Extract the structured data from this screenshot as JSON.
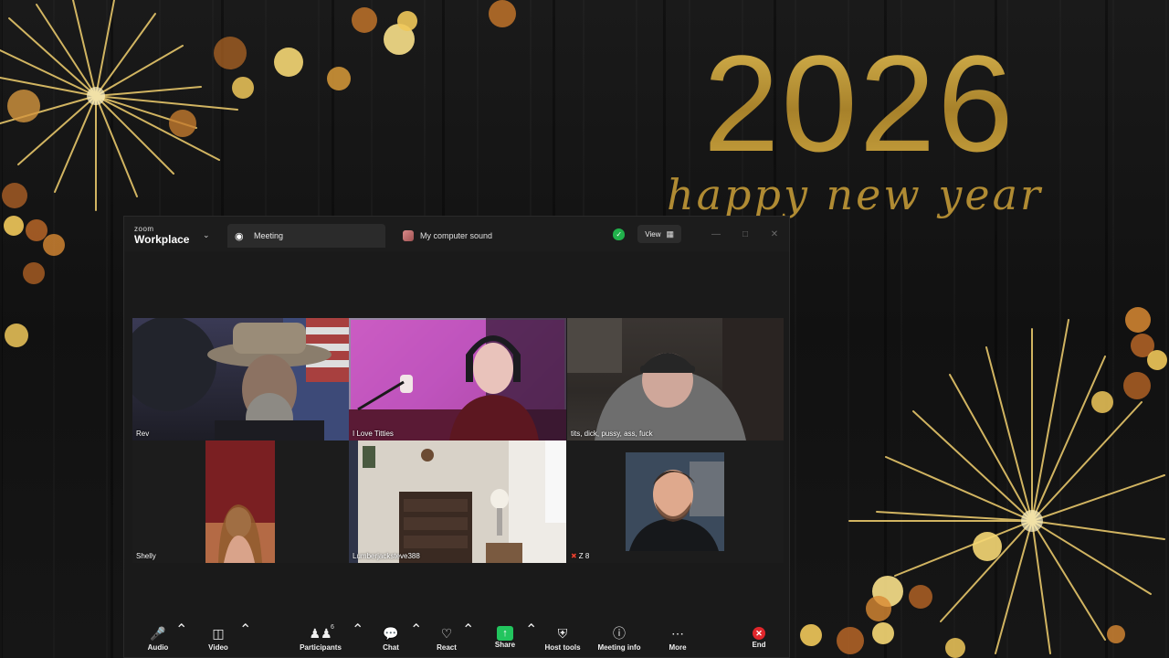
{
  "wallpaper": {
    "year_text": "2026",
    "greeting_text": "happy new year",
    "gold_color": "#c9a33f"
  },
  "app": {
    "brand_small": "zoom",
    "brand_large": "Workplace",
    "tabs": [
      {
        "label": "Meeting",
        "icon": "paw-icon"
      },
      {
        "label": "My computer sound",
        "icon": "app-icon"
      }
    ],
    "view_label": "View",
    "security_color": "#21b14b"
  },
  "gallery": {
    "participants": [
      {
        "name": "Rev",
        "active": false,
        "muted": false
      },
      {
        "name": "I Love Titties",
        "active": true,
        "muted": false
      },
      {
        "name": "tits, dick, pussy, ass, fuck",
        "active": false,
        "muted": false
      },
      {
        "name": "Shelly",
        "active": false,
        "muted": false
      },
      {
        "name": "Lumberjacksteve388",
        "active": false,
        "muted": false
      },
      {
        "name": "Z 8",
        "active": false,
        "muted": true
      }
    ],
    "active_border_color": "#4fd07a"
  },
  "toolbar": {
    "audio": "Audio",
    "video": "Video",
    "participants": "Participants",
    "participants_count": "6",
    "chat": "Chat",
    "react": "React",
    "share": "Share",
    "host_tools": "Host tools",
    "meeting_info": "Meeting info",
    "more": "More",
    "end": "End",
    "end_color": "#e0262b",
    "share_color": "#22c55e"
  }
}
